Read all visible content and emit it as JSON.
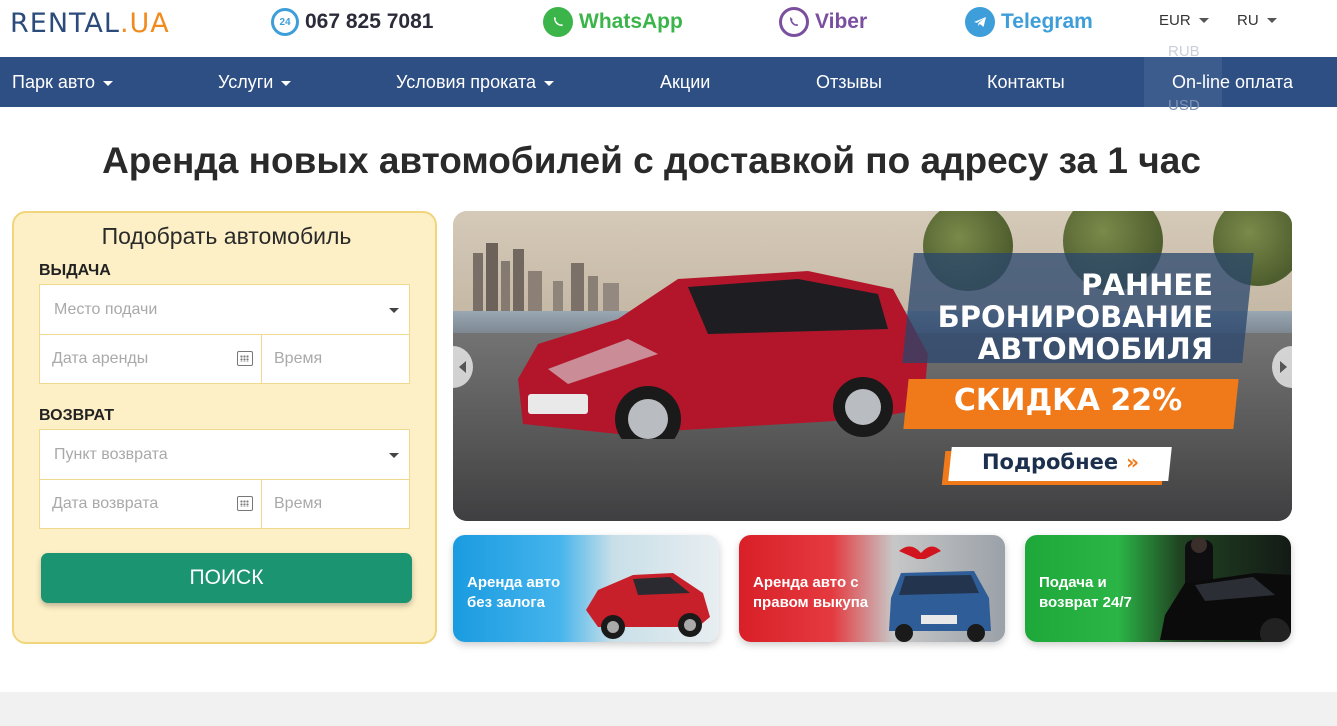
{
  "brand": {
    "logo_text": "RENTAL",
    "logo_dot": ".",
    "logo_suffix": "UA"
  },
  "contacts": {
    "phone_badge": "24",
    "phone": "067 825 7081",
    "whatsapp": "WhatsApp",
    "viber": "Viber",
    "telegram": "Telegram"
  },
  "currency": {
    "selected": "EUR",
    "options": [
      "RUB",
      "USD"
    ]
  },
  "language": {
    "selected": "RU"
  },
  "nav": {
    "items": [
      {
        "label": "Парк авто",
        "dropdown": true
      },
      {
        "label": "Услуги",
        "dropdown": true
      },
      {
        "label": "Условия проката",
        "dropdown": true
      },
      {
        "label": "Акции",
        "dropdown": false
      },
      {
        "label": "Отзывы",
        "dropdown": false
      },
      {
        "label": "Контакты",
        "dropdown": false
      },
      {
        "label": "On-line оплата",
        "dropdown": false
      }
    ]
  },
  "heading": "Аренда новых автомобилей с доставкой по адресу за 1 час",
  "search": {
    "title": "Подобрать автомобиль",
    "pickup": {
      "label": "ВЫДАЧА",
      "place_placeholder": "Место подачи",
      "date_placeholder": "Дата аренды",
      "time_placeholder": "Время"
    },
    "return": {
      "label": "ВОЗВРАТ",
      "place_placeholder": "Пункт возврата",
      "date_placeholder": "Дата возврата",
      "time_placeholder": "Время"
    },
    "button": "ПОИСК"
  },
  "banner": {
    "line1": "РАННЕЕ",
    "line2": "БРОНИРОВАНИЕ",
    "line3": "АВТОМОБИЛЯ",
    "sale": "СКИДКА 22%",
    "more": "Подробнее",
    "more_chevron": "»"
  },
  "tiles": [
    {
      "label": "Аренда авто без залога"
    },
    {
      "label": "Аренда авто с правом выкупа"
    },
    {
      "label": "Подача и возврат 24/7"
    }
  ],
  "colors": {
    "nav_bg": "#2e4f83",
    "accent_orange": "#f28a1e",
    "search_button": "#1b9472",
    "panel_bg": "#fdf0c6",
    "whatsapp": "#3bb54a",
    "viber": "#7b4fa0",
    "telegram": "#3d9ed9"
  }
}
